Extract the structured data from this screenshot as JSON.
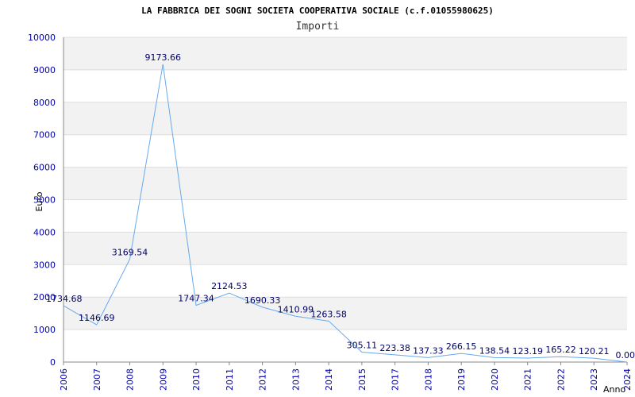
{
  "chart_data": {
    "type": "line",
    "title": "LA FABBRICA DEI SOGNI SOCIETA COOPERATIVA SOCIALE (c.f.01055980625)",
    "subtitle": "Importi",
    "xlabel": "Anno",
    "ylabel": "Euro",
    "ylim": [
      0,
      10000
    ],
    "yticks": [
      "0",
      "1000",
      "2000",
      "3000",
      "4000",
      "5000",
      "6000",
      "7000",
      "8000",
      "9000",
      "10000"
    ],
    "categories": [
      "2006",
      "2007",
      "2008",
      "2009",
      "2010",
      "2011",
      "2012",
      "2013",
      "2014",
      "2015",
      "2017",
      "2018",
      "2019",
      "2020",
      "2021",
      "2022",
      "2023",
      "2024"
    ],
    "values": [
      1734.68,
      1146.69,
      3169.54,
      9173.66,
      1747.34,
      2124.53,
      1690.33,
      1410.99,
      1263.58,
      305.11,
      223.38,
      137.33,
      266.15,
      138.54,
      123.19,
      165.22,
      120.21,
      0.0
    ],
    "value_labels": [
      "1734.68",
      "1146.69",
      "3169.54",
      "9173.66",
      "1747.34",
      "2124.53",
      "1690.33",
      "1410.99",
      "1263.58",
      "305.11",
      "223.38",
      "137.33",
      "266.15",
      "138.54",
      "123.19",
      "165.22",
      "120.21",
      "0.00"
    ],
    "grid": true,
    "colors": {
      "line": "#66aaee",
      "band": "#f2f2f2",
      "grid": "#dddddd",
      "axis": "#888888",
      "tick_text": "#0000aa",
      "label_text": "#000066"
    }
  }
}
